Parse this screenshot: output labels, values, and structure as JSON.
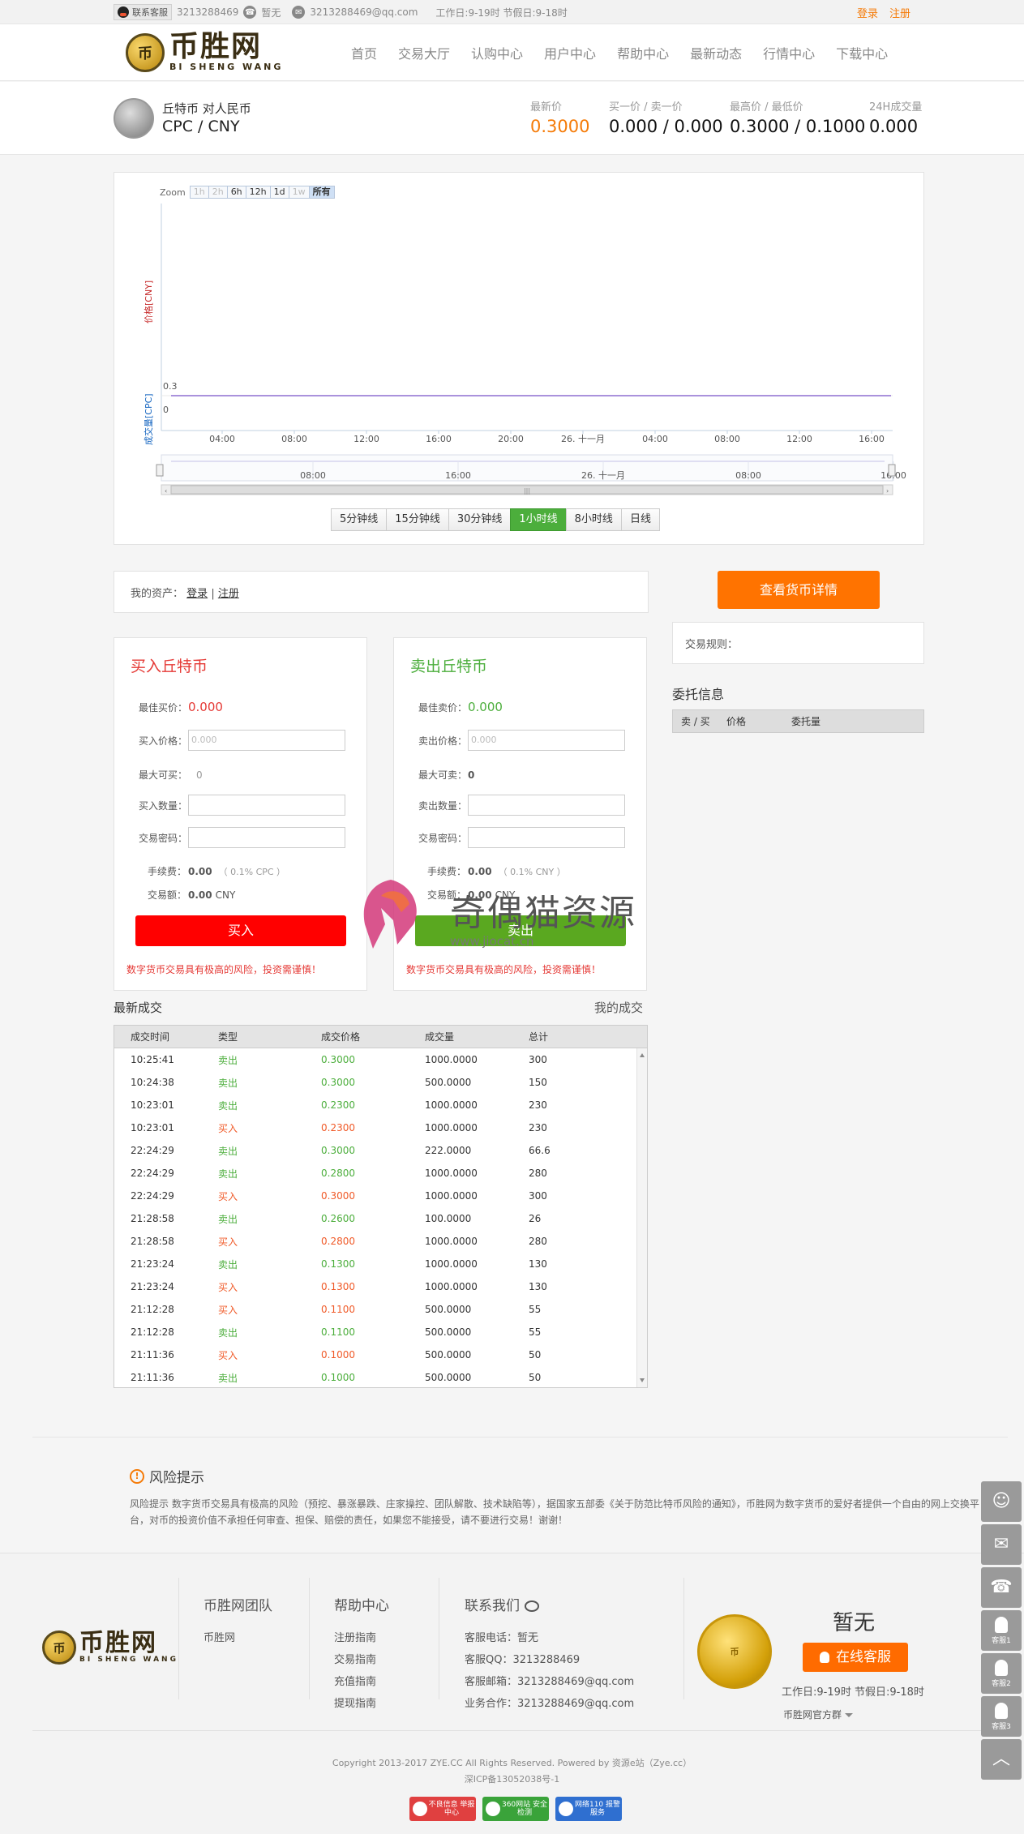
{
  "topbar": {
    "service_label": "联系客服",
    "qq": "3213288469",
    "phone": "暂无",
    "email": "3213288469@qq.com",
    "hours": "工作日:9-19时 节假日:9-18时",
    "login": "登录",
    "register": "注册"
  },
  "header": {
    "logo_cn": "币胜网",
    "logo_en": "BI SHENG WANG",
    "nav": [
      "首页",
      "交易大厅",
      "认购中心",
      "用户中心",
      "帮助中心",
      "最新动态",
      "行情中心",
      "下载中心"
    ]
  },
  "ticker": {
    "coin_name": "丘特币 对人民币",
    "pair": "CPC / CNY",
    "latest_label": "最新价",
    "latest_value": "0.3000",
    "bidask_label": "买一价 / 卖一价",
    "bidask_value": "0.000 / 0.000",
    "highlow_label": "最高价 / 最低价",
    "highlow_value": "0.3000 / 0.1000",
    "volume_label": "24H成交量",
    "volume_value": "0.000"
  },
  "chart": {
    "zoom_label": "Zoom",
    "zoom_buttons": [
      "1h",
      "2h",
      "6h",
      "12h",
      "1d",
      "1w",
      "所有"
    ],
    "price_axis_label": "价格[CNY]",
    "volume_axis_label": "成交量[CPC]",
    "intervals": [
      "5分钟线",
      "15分钟线",
      "30分钟线",
      "1小时线",
      "8小时线",
      "日线"
    ],
    "active_interval": "1小时线",
    "line_color": "#8d6fd1"
  },
  "chart_data": {
    "type": "line",
    "x_ticks": [
      "04:00",
      "08:00",
      "12:00",
      "16:00",
      "20:00",
      "26. 十一月",
      "04:00",
      "08:00",
      "12:00",
      "16:00"
    ],
    "navigator_ticks": [
      "08:00",
      "16:00",
      "26. 十一月",
      "08:00",
      "16:00"
    ],
    "y_ticks": [
      "0.3",
      "0"
    ],
    "series": [
      {
        "values": [
          0.3,
          0.3
        ]
      }
    ],
    "ylim": [
      0,
      0.3
    ]
  },
  "assets": {
    "label": "我的资产：",
    "login": "登录",
    "sep": "|",
    "register": "注册"
  },
  "buy": {
    "title": "买入丘特币",
    "best_label": "最佳买价：",
    "best_value": "0.000",
    "price_label": "买入价格：",
    "price_placeholder": "0.000",
    "max_label": "最大可买：",
    "max_value": "0",
    "qty_label": "买入数量：",
    "pwd_label": "交易密码：",
    "fee_label": "手续费：",
    "fee_value": "0.00",
    "fee_rate": "（ 0.1% CPC ）",
    "amount_label": "交易额：",
    "amount_value": "0.00",
    "amount_unit": "CNY",
    "button": "买入",
    "warning": "数字货币交易具有极高的风险，投资需谨慎！"
  },
  "sell": {
    "title": "卖出丘特币",
    "best_label": "最佳卖价：",
    "best_value": "0.000",
    "price_label": "卖出价格：",
    "price_placeholder": "0.000",
    "max_label": "最大可卖：",
    "max_value": "0",
    "qty_label": "卖出数量：",
    "pwd_label": "交易密码：",
    "fee_label": "手续费：",
    "fee_value": "0.00",
    "fee_rate": "（ 0.1% CNY ）",
    "amount_label": "交易额：",
    "amount_value": "0.00",
    "amount_unit": "CNY",
    "button": "卖出",
    "warning": "数字货币交易具有极高的风险，投资需谨慎！"
  },
  "right": {
    "detail_button": "查看货币详情",
    "rules_label": "交易规则：",
    "orders_title": "委托信息",
    "orders_cols": [
      "卖 / 买",
      "价格",
      "委托量"
    ]
  },
  "trades": {
    "title": "最新成交",
    "mine": "我的成交",
    "columns": [
      "成交时间",
      "类型",
      "成交价格",
      "成交量",
      "总计"
    ],
    "rows": [
      {
        "time": "10:25:41",
        "type": "卖出",
        "price": "0.3000",
        "qty": "1000.0000",
        "total": "300"
      },
      {
        "time": "10:24:38",
        "type": "卖出",
        "price": "0.3000",
        "qty": "500.0000",
        "total": "150"
      },
      {
        "time": "10:23:01",
        "type": "卖出",
        "price": "0.2300",
        "qty": "1000.0000",
        "total": "230"
      },
      {
        "time": "10:23:01",
        "type": "买入",
        "price": "0.2300",
        "qty": "1000.0000",
        "total": "230"
      },
      {
        "time": "22:24:29",
        "type": "卖出",
        "price": "0.3000",
        "qty": "222.0000",
        "total": "66.6"
      },
      {
        "time": "22:24:29",
        "type": "卖出",
        "price": "0.2800",
        "qty": "1000.0000",
        "total": "280"
      },
      {
        "time": "22:24:29",
        "type": "买入",
        "price": "0.3000",
        "qty": "1000.0000",
        "total": "300"
      },
      {
        "time": "21:28:58",
        "type": "卖出",
        "price": "0.2600",
        "qty": "100.0000",
        "total": "26"
      },
      {
        "time": "21:28:58",
        "type": "买入",
        "price": "0.2800",
        "qty": "1000.0000",
        "total": "280"
      },
      {
        "time": "21:23:24",
        "type": "卖出",
        "price": "0.1300",
        "qty": "1000.0000",
        "total": "130"
      },
      {
        "time": "21:23:24",
        "type": "买入",
        "price": "0.1300",
        "qty": "1000.0000",
        "total": "130"
      },
      {
        "time": "21:12:28",
        "type": "买入",
        "price": "0.1100",
        "qty": "500.0000",
        "total": "55"
      },
      {
        "time": "21:12:28",
        "type": "卖出",
        "price": "0.1100",
        "qty": "500.0000",
        "total": "55"
      },
      {
        "time": "21:11:36",
        "type": "买入",
        "price": "0.1000",
        "qty": "500.0000",
        "total": "50"
      },
      {
        "time": "21:11:36",
        "type": "卖出",
        "price": "0.1000",
        "qty": "500.0000",
        "total": "50"
      }
    ]
  },
  "risk": {
    "title": "风险提示",
    "text": "风险提示 数字货币交易具有极高的风险（预挖、暴涨暴跌、庄家操控、团队解散、技术缺陷等），据国家五部委《关于防范比特币风险的通知》，币胜网为数字货币的爱好者提供一个自由的网上交换平台，对币的投资价值不承担任何审查、担保、赔偿的责任，如果您不能接受，请不要进行交易！谢谢！"
  },
  "footer": {
    "team_title": "币胜网团队",
    "team_items": [
      "币胜网"
    ],
    "help_title": "帮助中心",
    "help_items": [
      "注册指南",
      "交易指南",
      "充值指南",
      "提现指南"
    ],
    "contact_title": "联系我们",
    "contact_items": [
      "客服电话：暂无",
      "客服QQ：3213288469",
      "客服邮箱：3213288469@qq.com",
      "业务合作：3213288469@qq.com"
    ],
    "phone_none": "暂无",
    "online_service": "在线客服",
    "hours": "工作日:9-19时 节假日:9-18时",
    "group": "币胜网官方群",
    "copyright": "Copyright 2013-2017 ZYE.CC All Rights Reserved. Powered by 资源e站（Zye.cc）",
    "icp": "深ICP备13052038号-1",
    "badges": [
      "不良信息 举报中心",
      "360网站 安全检测",
      "网络110 报警服务"
    ]
  },
  "side": {
    "service1": "客服1",
    "service2": "客服2",
    "service3": "客服3"
  },
  "watermark": {
    "text": "奇偶猫资源",
    "url": "www.jiocat.cn"
  }
}
